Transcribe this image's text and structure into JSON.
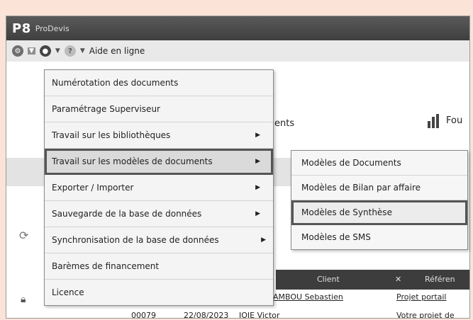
{
  "app": {
    "logo": "P8",
    "name": "ProDevis"
  },
  "toolbar": {
    "help_label": "Aide en ligne"
  },
  "background": {
    "tab_ents": "ents",
    "tab_fou": "Fou",
    "columns": [
      "Client",
      "Référen"
    ],
    "row1": {
      "client": "AMBOU Sebastien",
      "reference": "Projet portail"
    },
    "row2": {
      "number": "00079",
      "date": "22/08/2023",
      "client": "JOIE Victor",
      "reference": "Votre projet de"
    }
  },
  "menu": {
    "items": [
      {
        "label": "Numérotation des documents",
        "submenu": false
      },
      {
        "label": "Paramétrage Superviseur",
        "submenu": false
      },
      {
        "label": "Travail sur les bibliothèques",
        "submenu": true
      },
      {
        "label": "Travail sur les modèles de documents",
        "submenu": true
      },
      {
        "label": "Exporter / Importer",
        "submenu": true
      },
      {
        "label": "Sauvegarde de la base de données",
        "submenu": true
      },
      {
        "label": "Synchronisation de la base de données",
        "submenu": true
      },
      {
        "label": "Barèmes de financement",
        "submenu": false
      },
      {
        "label": "Licence",
        "submenu": false
      }
    ]
  },
  "submenu": {
    "items": [
      {
        "label": "Modèles de Documents"
      },
      {
        "label": "Modèles de Bilan par affaire"
      },
      {
        "label": "Modèles de Synthèse"
      },
      {
        "label": "Modèles de SMS"
      }
    ]
  },
  "colors": {
    "titlebar": "#4a4a4a",
    "highlight_border": "#555555",
    "background": "#fbe3d8"
  }
}
